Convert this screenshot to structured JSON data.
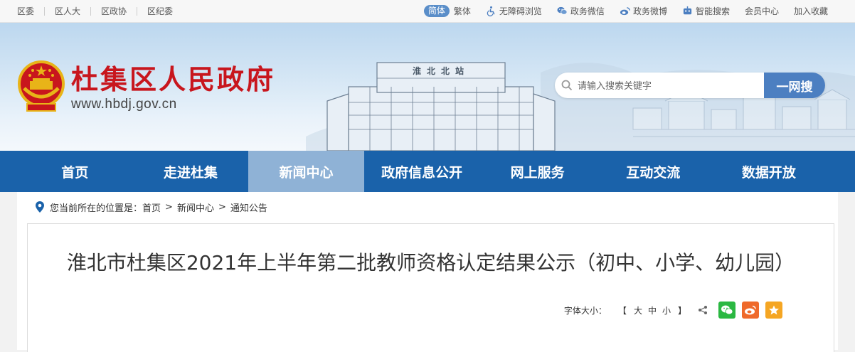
{
  "topbar": {
    "links": [
      "区委",
      "区人大",
      "区政协",
      "区纪委"
    ],
    "simplified": "简体",
    "traditional": "繁体",
    "accessibility": "无障碍浏览",
    "wechat": "政务微信",
    "weibo": "政务微博",
    "smart_search": "智能搜索",
    "member_center": "会员中心",
    "favorites": "加入收藏"
  },
  "header": {
    "site_name": "杜集区人民政府",
    "site_url": "www.hbdj.gov.cn",
    "station_sign": "淮北北站"
  },
  "search": {
    "placeholder": "请输入搜索关键字",
    "button_label": "一网搜"
  },
  "nav": {
    "items": [
      "首页",
      "走进杜集",
      "新闻中心",
      "政府信息公开",
      "网上服务",
      "互动交流",
      "数据开放"
    ],
    "active_index": 2
  },
  "breadcrumb": {
    "prefix": "您当前所在的位置是：",
    "items": [
      "首页",
      "新闻中心",
      "通知公告"
    ],
    "separator": ">"
  },
  "article": {
    "title": "淮北市杜集区2021年上半年第二批教师资格认定结果公示（初中、小学、幼儿园）"
  },
  "tools": {
    "font_size_label": "字体大小：",
    "bracket_open": "【",
    "bracket_close": "】",
    "sizes": [
      "大",
      "中",
      "小"
    ]
  },
  "colors": {
    "nav_bg": "#1a62aa",
    "nav_active": "#8fb2d6",
    "site_name": "#c8161d",
    "search_button": "#4c7fc1",
    "wechat": "#2bb842",
    "weibo": "#ef6a2b",
    "favorite": "#f5a623"
  }
}
